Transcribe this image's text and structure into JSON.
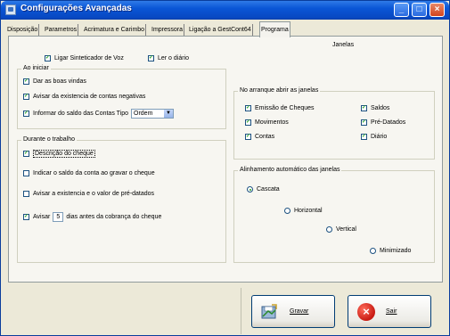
{
  "window": {
    "title": "Configurações Avançadas",
    "minimize_glyph": "_",
    "maximize_glyph": "□",
    "close_glyph": "×"
  },
  "tabs": [
    {
      "label": "Disposição",
      "active": false
    },
    {
      "label": "Parametros",
      "active": false
    },
    {
      "label": "Acrimatura e Carimbo",
      "active": false
    },
    {
      "label": "Impressora",
      "active": false
    },
    {
      "label": "Ligação a GestCont64",
      "active": false
    },
    {
      "label": "Programa",
      "active": true
    }
  ],
  "janelas_label": "Janelas",
  "top_options": {
    "semaforo": {
      "label": "Ligar Sinteticador de Voz",
      "checked": true
    },
    "diario": {
      "label": "Ler o diário",
      "checked": true
    }
  },
  "ao_iniciar": {
    "legend": "Ao iniciar",
    "items": [
      {
        "label": "Dar as boas vindas",
        "checked": true
      },
      {
        "label": "Avisar da existencia de contas negativas",
        "checked": true
      }
    ],
    "saldo_label": "Informar do saldo das Contas Tipo",
    "saldo_select": "Ordem"
  },
  "durante": {
    "legend": "Durante o trabalho",
    "items": [
      {
        "label": "Descrição do cheque",
        "checked": true
      },
      {
        "label": "Indicar o saldo da conta ao gravar o cheque",
        "checked": false
      },
      {
        "label": "Avisar a existencia e o valor de pré-datados",
        "checked": false
      }
    ],
    "avisar_prefix": "Avisar",
    "avisar_days": "5",
    "avisar_suffix": "dias antes da cobrança do cheque",
    "avisar_checked": true
  },
  "arranque": {
    "legend": "No arranque abrir as janelas",
    "items": [
      {
        "label": "Emissão de Cheques",
        "checked": true
      },
      {
        "label": "Saldos",
        "checked": true
      },
      {
        "label": "Movimentos",
        "checked": true
      },
      {
        "label": "Pré-Datados",
        "checked": true
      },
      {
        "label": "Contas",
        "checked": true
      },
      {
        "label": "Diário",
        "checked": true
      }
    ]
  },
  "alinhamento": {
    "legend": "Alinhamento automático das janelas",
    "options": [
      {
        "label": "Cascata",
        "selected": true
      },
      {
        "label": "Horizontal",
        "selected": false
      },
      {
        "label": "Vertical",
        "selected": false
      },
      {
        "label": "Minimizado",
        "selected": false
      }
    ]
  },
  "buttons": {
    "save_label": "Gravar",
    "exit_label": "Sair"
  },
  "colors": {
    "titlebar": "#0a56d6",
    "check": "#21a121"
  }
}
